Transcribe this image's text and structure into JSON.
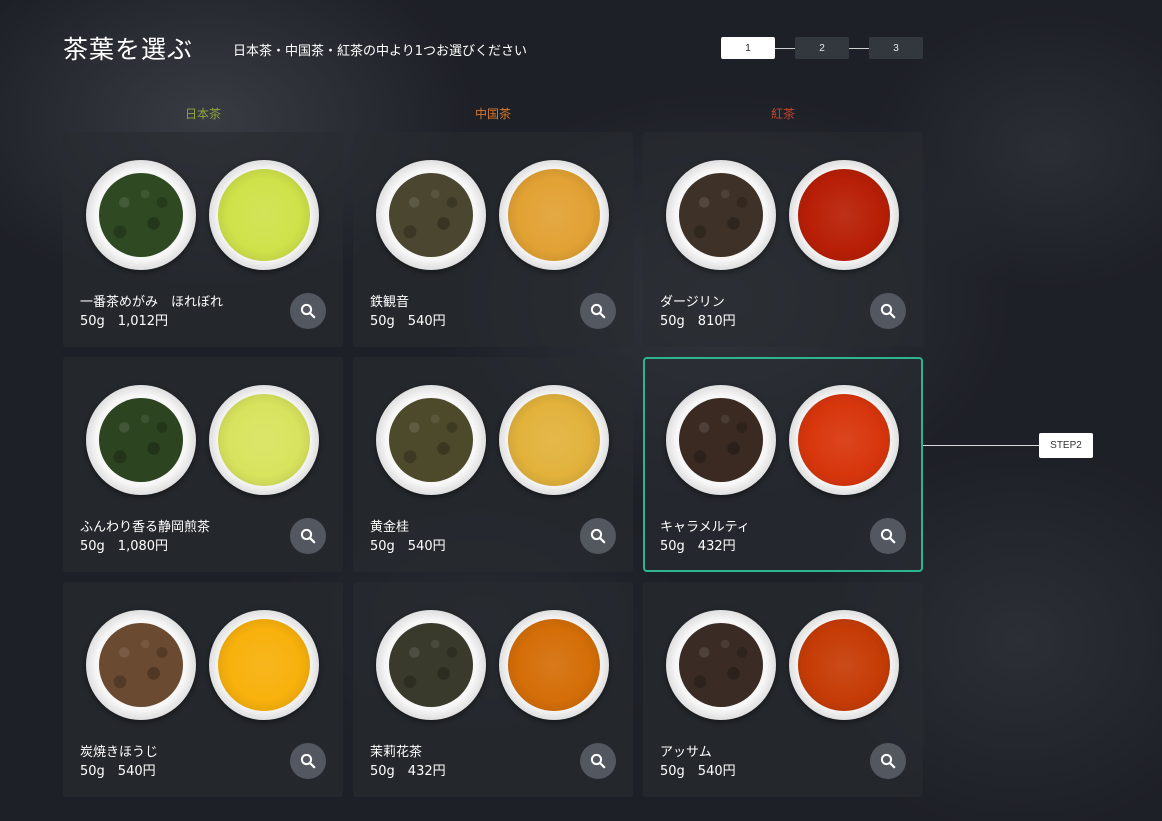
{
  "header": {
    "title": "茶葉を選ぶ",
    "subtitle": "日本茶・中国茶・紅茶の中より1つお選びください"
  },
  "stepper": {
    "steps": [
      "1",
      "2",
      "3"
    ],
    "current": "1"
  },
  "columns": [
    {
      "label": "日本茶",
      "color": "#8fa63e"
    },
    {
      "label": "中国茶",
      "color": "#d9782a"
    },
    {
      "label": "紅茶",
      "color": "#c7462c"
    }
  ],
  "teas": [
    {
      "name": "一番茶めがみ　ほれぼれ",
      "price": "50g　1,012円",
      "leaf_color": "#2f4a22",
      "liquor_color": "#cfe24a"
    },
    {
      "name": "鉄観音",
      "price": "50g　540円",
      "leaf_color": "#4a4630",
      "liquor_color": "#e2a234"
    },
    {
      "name": "ダージリン",
      "price": "50g　810円",
      "leaf_color": "#3e3228",
      "liquor_color": "#b81f06"
    },
    {
      "name": "ふんわり香る静岡煎茶",
      "price": "50g　1,080円",
      "leaf_color": "#2c4420",
      "liquor_color": "#d8e45e"
    },
    {
      "name": "黄金桂",
      "price": "50g　540円",
      "leaf_color": "#4d4a2c",
      "liquor_color": "#e2b23c"
    },
    {
      "name": "キャラメルティ",
      "price": "50g　432円",
      "leaf_color": "#3a2a22",
      "liquor_color": "#d8360c"
    },
    {
      "name": "炭焼きほうじ",
      "price": "50g　540円",
      "leaf_color": "#6a4a30",
      "liquor_color": "#f8b10c"
    },
    {
      "name": "茉莉花茶",
      "price": "50g　432円",
      "leaf_color": "#3a3a2c",
      "liquor_color": "#d46e08"
    },
    {
      "name": "アッサム",
      "price": "50g　540円",
      "leaf_color": "#3a2c24",
      "liquor_color": "#c63c06"
    }
  ],
  "selected_tea": "キャラメルティ",
  "callout": {
    "label": "STEP2"
  },
  "icons": {
    "zoom": "search-icon"
  }
}
